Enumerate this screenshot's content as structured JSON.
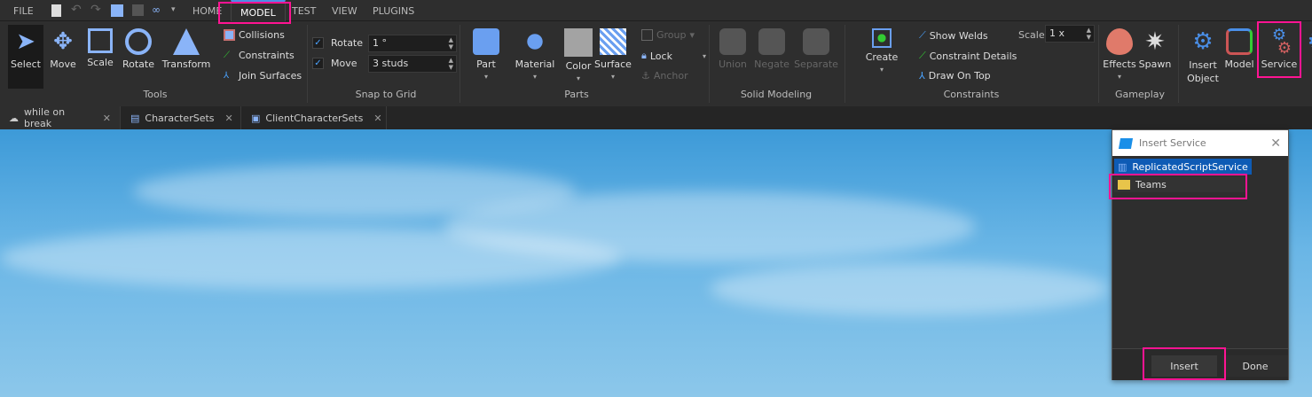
{
  "menubar": {
    "file": "FILE",
    "tabs": [
      "HOME",
      "MODEL",
      "TEST",
      "VIEW",
      "PLUGINS"
    ],
    "active_tab": "MODEL"
  },
  "ribbon": {
    "tools": {
      "label": "Tools",
      "buttons": [
        "Select",
        "Move",
        "Scale",
        "Rotate",
        "Transform"
      ],
      "options": [
        "Collisions",
        "Constraints",
        "Join Surfaces"
      ]
    },
    "snap": {
      "label": "Snap to Grid",
      "rotate_label": "Rotate",
      "rotate_value": "1 °",
      "rotate_checked": true,
      "move_label": "Move",
      "move_value": "3 studs",
      "move_checked": true
    },
    "parts": {
      "label": "Parts",
      "buttons": [
        "Part",
        "Material",
        "Color",
        "Surface"
      ],
      "group": "Group",
      "lock": "Lock",
      "anchor": "Anchor"
    },
    "solid": {
      "label": "Solid Modeling",
      "buttons": [
        "Union",
        "Negate",
        "Separate"
      ]
    },
    "constraints": {
      "label": "Constraints",
      "create": "Create",
      "show_welds": "Show Welds",
      "details": "Constraint Details",
      "draw_on_top": "Draw On Top",
      "scale_label": "Scale",
      "scale_value": "1 x"
    },
    "gameplay": {
      "label": "Gameplay",
      "buttons": [
        "Effects",
        "Spawn"
      ]
    },
    "advanced": {
      "insert_object": [
        "Insert",
        "Object"
      ],
      "model": "Model",
      "service": "Service"
    }
  },
  "doc_tabs": [
    {
      "label": "while on break",
      "icon": "cloud-icon"
    },
    {
      "label": "CharacterSets",
      "icon": "script-icon"
    },
    {
      "label": "ClientCharacterSets",
      "icon": "local-script-icon"
    }
  ],
  "dialog": {
    "title": "Insert Service",
    "items": [
      {
        "label": "ReplicatedScriptService",
        "selected": true
      },
      {
        "label": "Teams",
        "selected": false
      }
    ],
    "insert": "Insert",
    "done": "Done"
  },
  "colors": {
    "accent": "#4a8fe8",
    "highlight": "#ff1493",
    "selection": "#0e5bb5"
  }
}
